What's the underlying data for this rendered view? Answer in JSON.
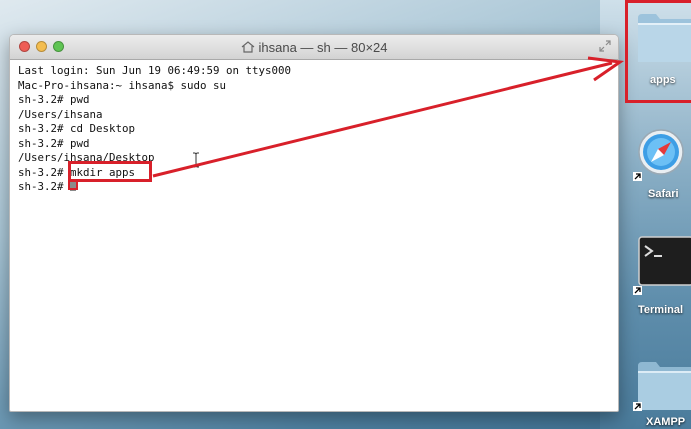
{
  "window": {
    "title": "ihsana — sh — 80×24",
    "lines": [
      "Last login: Sun Jun 19 06:49:59 on ttys000",
      "Mac-Pro-ihsana:~ ihsana$ sudo su",
      "sh-3.2# pwd",
      "/Users/ihsana",
      "sh-3.2# cd Desktop",
      "sh-3.2# pwd",
      "/Users/ihsana/Desktop",
      "sh-3.2# mkdir apps",
      "sh-3.2# "
    ]
  },
  "desktop": {
    "items": [
      {
        "label": "apps"
      },
      {
        "label": "Safari"
      },
      {
        "label": "Terminal"
      },
      {
        "label": "XAMPP"
      }
    ]
  },
  "colors": {
    "highlight": "#d8202a",
    "desktop": "#6f9bb6"
  }
}
